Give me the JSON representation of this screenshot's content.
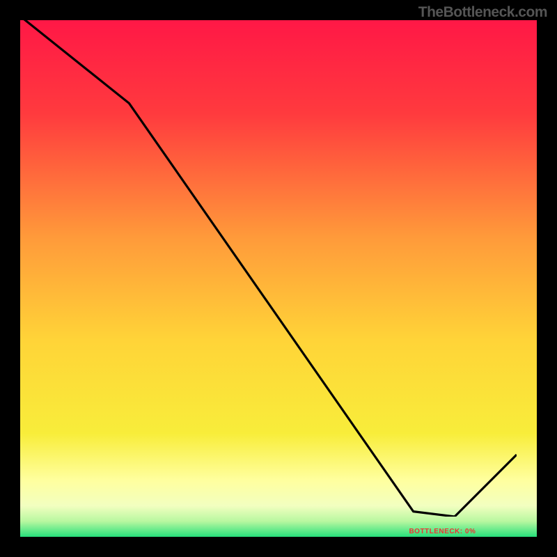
{
  "watermark": "TheBottleneck.com",
  "bottleneck_label": "BOTTLENECK: 0%",
  "chart_data": {
    "type": "line",
    "title": "",
    "xlabel": "",
    "ylabel": "",
    "xlim": [
      0,
      100
    ],
    "ylim": [
      0,
      100
    ],
    "x": [
      0,
      25,
      80,
      88,
      100
    ],
    "values": [
      100,
      80,
      1,
      0,
      12
    ],
    "background_gradient": {
      "top": "#ff1846",
      "mid_orange": "#ffa23c",
      "mid_yellow": "#ffe838",
      "pale_yellow": "#ffffa0",
      "green": "#26e07b"
    },
    "annotations": [
      {
        "text": "BOTTLENECK: 0%",
        "x": 82,
        "y": 1
      }
    ]
  }
}
